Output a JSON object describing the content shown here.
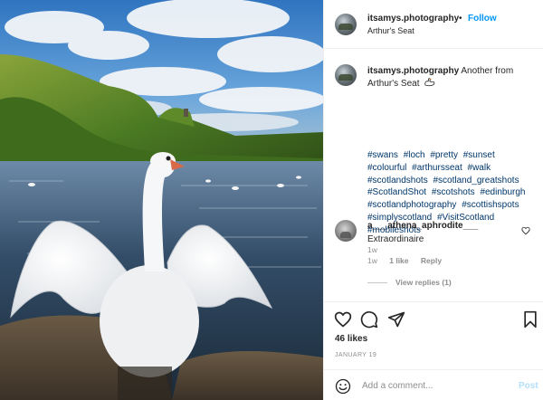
{
  "post": {
    "username": "itsamys.photography",
    "follow_dot": "•",
    "follow_label": "Follow",
    "location": "Arthur's Seat",
    "caption": {
      "username": "itsamys.photography",
      "text": "Another from Arthur's Seat",
      "emoji_icon": "swan-emoji",
      "hashtags": [
        "#swans",
        "#loch",
        "#pretty",
        "#sunset",
        "#colourful",
        "#arthursseat",
        "#walk",
        "#scotlandshots",
        "#scotland_greatshots",
        "#ScotlandShot",
        "#scotshots",
        "#edinburgh",
        "#scotlandphotography",
        "#scottishspots",
        "#simplyscotland",
        "#VisitScotland",
        "#mobileshots"
      ],
      "time": "1w"
    },
    "comments": [
      {
        "username": "a___athena_aphrodite___",
        "text": "Extraordinaire",
        "time": "1w",
        "likes": "1 like",
        "reply": "Reply",
        "view_replies": "View replies (1)"
      }
    ],
    "likes_count": "46 likes",
    "date": "JANUARY 19",
    "comment_input": {
      "placeholder": "Add a comment...",
      "post_label": "Post"
    }
  },
  "icons": {
    "like": "heart-icon",
    "comment": "comment-icon",
    "share": "paper-plane-icon",
    "save": "bookmark-icon",
    "emoji": "smiley-icon"
  },
  "colors": {
    "link": "#00376b",
    "follow": "#0095f6",
    "muted": "#8e8e8e",
    "post_disabled": "#b2dffc"
  }
}
